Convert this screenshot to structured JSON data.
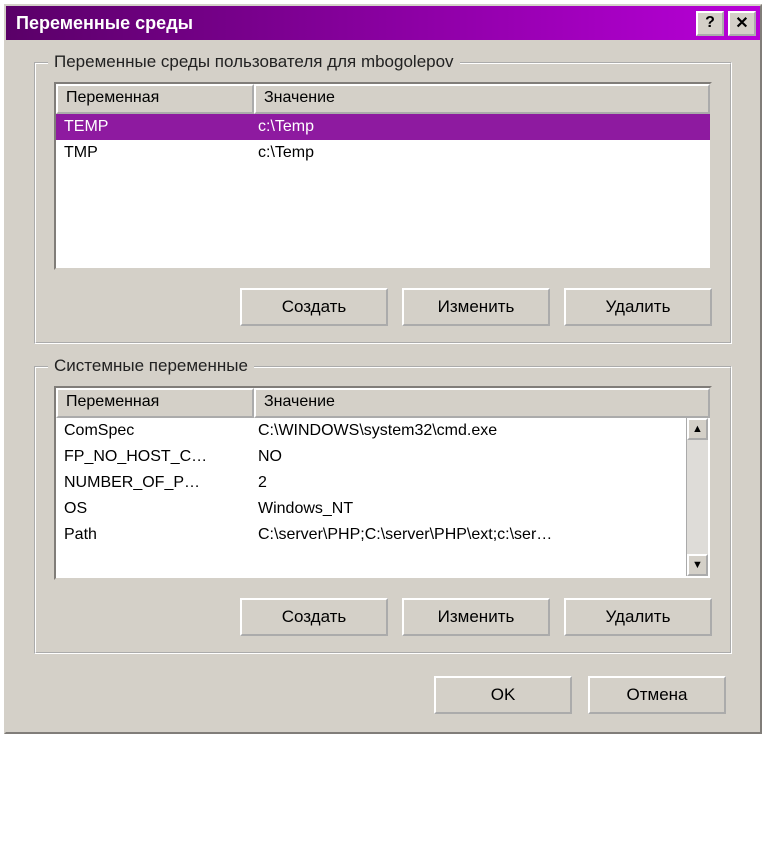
{
  "window": {
    "title": "Переменные среды"
  },
  "userGroup": {
    "legend": "Переменные среды пользователя для mbogolepov",
    "headers": {
      "name": "Переменная",
      "value": "Значение"
    },
    "rows": [
      {
        "name": "TEMP",
        "value": "c:\\Temp",
        "selected": true
      },
      {
        "name": "TMP",
        "value": "c:\\Temp",
        "selected": false
      }
    ],
    "buttons": {
      "new": "Создать",
      "edit": "Изменить",
      "delete": "Удалить"
    }
  },
  "systemGroup": {
    "legend": "Системные переменные",
    "headers": {
      "name": "Переменная",
      "value": "Значение"
    },
    "rows": [
      {
        "name": "ComSpec",
        "value": "C:\\WINDOWS\\system32\\cmd.exe",
        "selected": false
      },
      {
        "name": "FP_NO_HOST_C…",
        "value": "NO",
        "selected": false
      },
      {
        "name": "NUMBER_OF_P…",
        "value": "2",
        "selected": false
      },
      {
        "name": "OS",
        "value": "Windows_NT",
        "selected": false
      },
      {
        "name": "Path",
        "value": "C:\\server\\PHP;C:\\server\\PHP\\ext;c:\\ser…",
        "selected": false
      }
    ],
    "buttons": {
      "new": "Создать",
      "edit": "Изменить",
      "delete": "Удалить"
    }
  },
  "dialogButtons": {
    "ok": "OK",
    "cancel": "Отмена"
  }
}
